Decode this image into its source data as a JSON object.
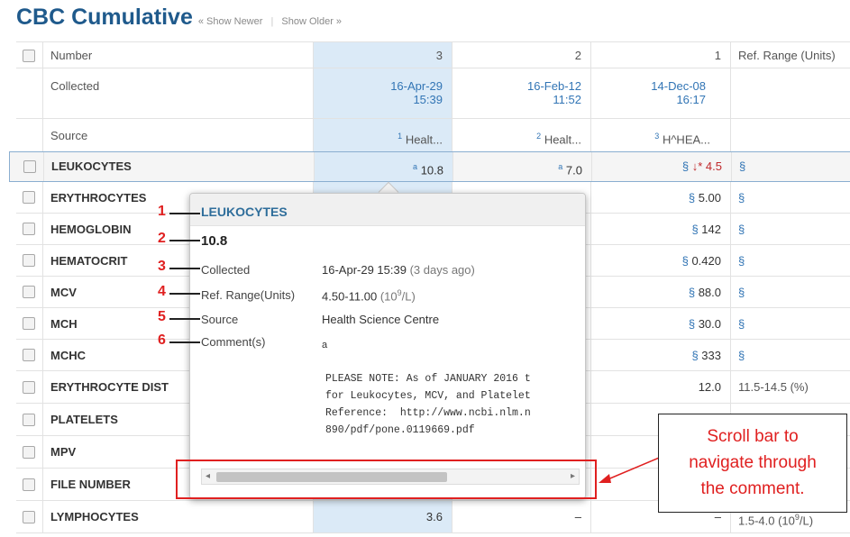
{
  "page": {
    "title": "CBC Cumulative",
    "show_newer": "« Show Newer",
    "separator": "|",
    "show_older": "Show Older »"
  },
  "columns": {
    "number_label": "Number",
    "collected_label": "Collected",
    "source_label": "Source",
    "ref_range_header": "Ref. Range (Units)",
    "results": [
      {
        "number": "3",
        "date": "16-Apr-29",
        "time": "15:39",
        "source_sup": "1",
        "source": "Healt..."
      },
      {
        "number": "2",
        "date": "16-Feb-12",
        "time": "11:52",
        "source_sup": "2",
        "source": "Healt..."
      },
      {
        "number": "1",
        "date": "14-Dec-08",
        "time": "16:17",
        "source_sup": "3",
        "source": "H^HEA..."
      }
    ]
  },
  "rows": [
    {
      "name": "LEUKOCYTES",
      "c3_sup": "a",
      "c3": "10.8",
      "c2_sup": "a",
      "c2": "7.0",
      "c1_prefix": "§",
      "c1_flag": "↓*",
      "c1": "4.5",
      "ref": "§"
    },
    {
      "name": "ERYTHROCYTES",
      "c1_prefix": "§",
      "c1": "5.00",
      "ref": "§"
    },
    {
      "name": "HEMOGLOBIN",
      "c1_prefix": "§",
      "c1": "142",
      "ref": "§"
    },
    {
      "name": "HEMATOCRIT",
      "c1_prefix": "§",
      "c1": "0.420",
      "ref": "§"
    },
    {
      "name": "MCV",
      "c1_prefix": "§",
      "c1": "88.0",
      "ref": "§"
    },
    {
      "name": "MCH",
      "c1_prefix": "§",
      "c1": "30.0",
      "ref": "§"
    },
    {
      "name": "MCHC",
      "c1_prefix": "§",
      "c1": "333",
      "ref": "§"
    },
    {
      "name": "ERYTHROCYTE DIST",
      "c1": "12.0",
      "ref": "11.5-14.5 (%)"
    },
    {
      "name": "PLATELETS"
    },
    {
      "name": "MPV"
    },
    {
      "name": "FILE NUMBER"
    },
    {
      "name": "LYMPHOCYTES",
      "c3": "3.6",
      "c2": "–",
      "c1": "–",
      "ref": "1.5-4.0 (10",
      "ref_sup": "9",
      "ref_tail": "/L)"
    }
  ],
  "popup": {
    "title": "LEUKOCYTES",
    "value": "10.8",
    "collected_label": "Collected",
    "collected_value": "16-Apr-29 15:39",
    "collected_ago": "(3 days ago)",
    "ref_label": "Ref. Range(Units)",
    "ref_value": "4.50-11.00",
    "ref_units": "(10",
    "ref_units_sup": "9",
    "ref_units_tail": "/L)",
    "source_label": "Source",
    "source_value": "Health Science Centre",
    "comment_label": "Comment(s)",
    "comment_marker": "a",
    "comment_lines": [
      "PLEASE NOTE: As of JANUARY 2016 t",
      "for Leukocytes, MCV, and Platelet",
      "Reference:  http://www.ncbi.nlm.n",
      "890/pdf/pone.0119669.pdf"
    ]
  },
  "annotations": {
    "numbers": [
      "1",
      "2",
      "3",
      "4",
      "5",
      "6"
    ],
    "callout_lines": [
      "Scroll bar to",
      "navigate through",
      "the comment."
    ]
  },
  "colors": {
    "accent": "#1f5a8c",
    "highlight_col": "#dbeaf7",
    "annotation_red": "#e02020",
    "abnormal": "#c0282b"
  }
}
